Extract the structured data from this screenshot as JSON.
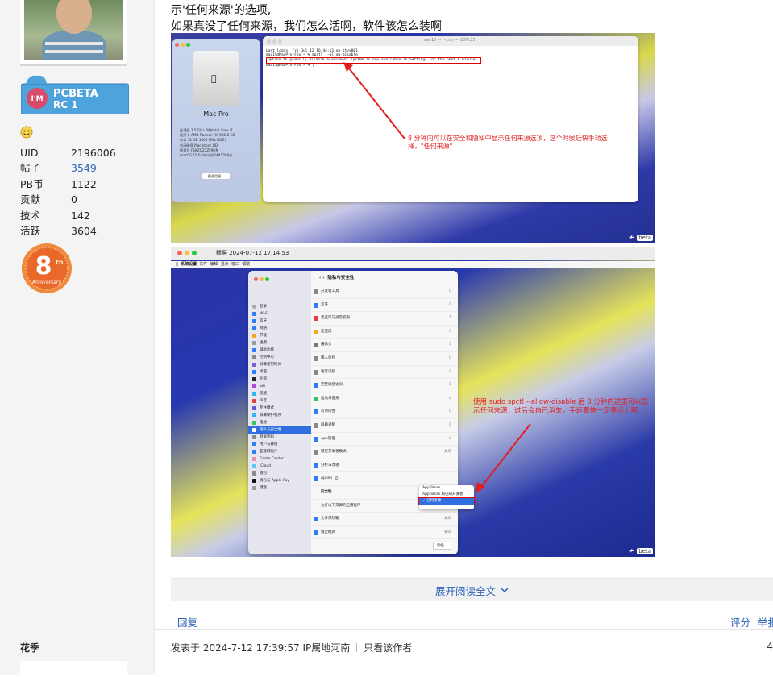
{
  "profile": {
    "badge_pcbeta": "I'M PCBETA RC 1",
    "stats": [
      {
        "label": "UID",
        "value": "2196006",
        "link": false
      },
      {
        "label": "帖子",
        "value": "3549",
        "link": true
      },
      {
        "label": "PB币",
        "value": "1122",
        "link": false
      },
      {
        "label": "贡献",
        "value": "0",
        "link": false
      },
      {
        "label": "技术",
        "value": "142",
        "link": false
      },
      {
        "label": "活跃",
        "value": "3604",
        "link": false
      }
    ],
    "medal_text": "8th Anniversary"
  },
  "post": {
    "line1": "示'任何来源'的选项,",
    "line2": "如果真没了任何来源，我们怎么活啊，软件该怎么装啊",
    "expand_label": "展开阅读全文",
    "reply_label": "回复",
    "rate_label": "评分",
    "report_label": "举报"
  },
  "screenshot1": {
    "mac_title": "Mac Pro",
    "mac_specs": [
      "处理器 3.5 GHz 四核Intel Core i7",
      "图形卡 AMD Radeon RX 580 8 GB",
      "内存 32 GB 1600 MHz DDR3",
      "启动磁盘 Macintosh HD",
      "序列号 F5KZGZ2ZF9QM",
      "macOS 15.0 Beta版(24A5289g)"
    ],
    "more_button": "更多信息...",
    "terminal_title": "mac15 — -zsh — 107x35",
    "terminal_lines": [
      "Last login: Fri Jul 12 16:44:13 on ttys001",
      "mac15@MacPro-Fox ~ % spctl --allow-disable",
      "Option to globally disable assessment system is now available in Settings for the next 8 minutes.",
      "mac15@MacPro-Fox ~ % |"
    ],
    "annotation": "8 分钟内可以在安全和隐私中显示任何来源选项，这个时候赶快手动选择，\"任何来源\"",
    "logo": "beta"
  },
  "screenshot2": {
    "window_title": "截屏 2024-07-12 17.14.53",
    "menu_items": [
      "系统设置",
      "文件",
      "编辑",
      "显示",
      "窗口",
      "帮助"
    ],
    "panel_title": "隐私与安全性",
    "sidebar_items": [
      "登录",
      "Wi-Fi",
      "蓝牙",
      "网络",
      "节能",
      "通用",
      "辅助功能",
      "控制中心",
      "屏幕使用时间",
      "桌面",
      "外观",
      "Siri",
      "壁纸",
      "声音",
      "专注模式",
      "屏幕保护程序",
      "电池",
      "隐私与安全性",
      "登录密码",
      "用户与群组",
      "互联网账户",
      "Game Center",
      "iCloud",
      "钱包",
      "钱包与 Apple Pay",
      "键盘"
    ],
    "main_rows": [
      {
        "label": "开发者工具",
        "value": "0"
      },
      {
        "label": "蓝牙",
        "value": "0"
      },
      {
        "label": "麦克风与录音权限",
        "value": "1"
      },
      {
        "label": "麦克风",
        "value": "0"
      },
      {
        "label": "摄像头",
        "value": "0"
      },
      {
        "label": "输入监控",
        "value": "0"
      },
      {
        "label": "语音识别",
        "value": "0"
      },
      {
        "label": "完整磁盘访问",
        "value": "0"
      },
      {
        "label": "运动与健身",
        "value": "0"
      },
      {
        "label": "可访问性",
        "value": "0"
      },
      {
        "label": "屏幕录制",
        "value": "0"
      },
      {
        "label": "App管理",
        "value": "0"
      },
      {
        "label": "锁定开发者模式",
        "value": "关闭"
      },
      {
        "label": "分析与改进",
        "value": ""
      },
      {
        "label": "Apple广告",
        "value": ""
      },
      {
        "label": "安全性",
        "value": ""
      },
      {
        "label": "允许以下来源的应用程序",
        "value": ""
      },
      {
        "label": "文件保险箱",
        "value": "关闭"
      },
      {
        "label": "锁定模式",
        "value": "关闭"
      }
    ],
    "popup_options": [
      "App Store",
      "App Store 和已知开发者",
      "任何来源"
    ],
    "popup_selected": "任何来源",
    "annotation": "使用 sudo spctl --allow-disable 后 8 分钟内这里可以显示任何来源，过后会自己消失，手速要快一定要点上啊",
    "logo": "beta",
    "advanced_button": "高级..."
  },
  "next_post": {
    "author": "花季",
    "meta_posted": "发表于 2024-7-12 17:39:57 IP属地河南",
    "meta_only_author": "只看该作者",
    "floor": "4"
  },
  "colors": {
    "link": "#2b62b6",
    "annotation": "#e02020",
    "selected": "#2f6fe0"
  }
}
